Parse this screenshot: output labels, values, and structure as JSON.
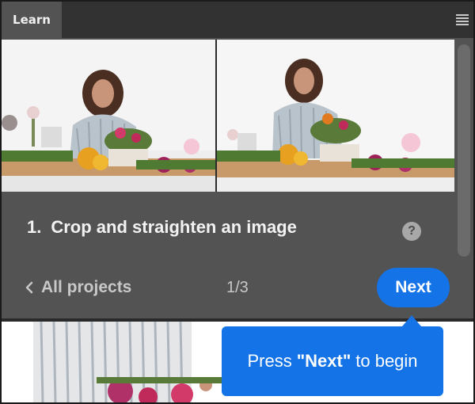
{
  "panel": {
    "tab_label": "Learn",
    "menu_icon": "hamburger-menu-icon"
  },
  "lesson": {
    "step_number": "1.",
    "step_title": "Crop and straighten an image",
    "help_icon_glyph": "?",
    "back_label": "All projects",
    "progress": "1/3",
    "next_label": "Next"
  },
  "tooltip": {
    "prefix": "Press",
    "highlight": "\"Next\"",
    "suffix": "to begin"
  },
  "colors": {
    "panel_bg": "#535353",
    "header_bg": "#323232",
    "accent_blue": "#1473e6"
  }
}
